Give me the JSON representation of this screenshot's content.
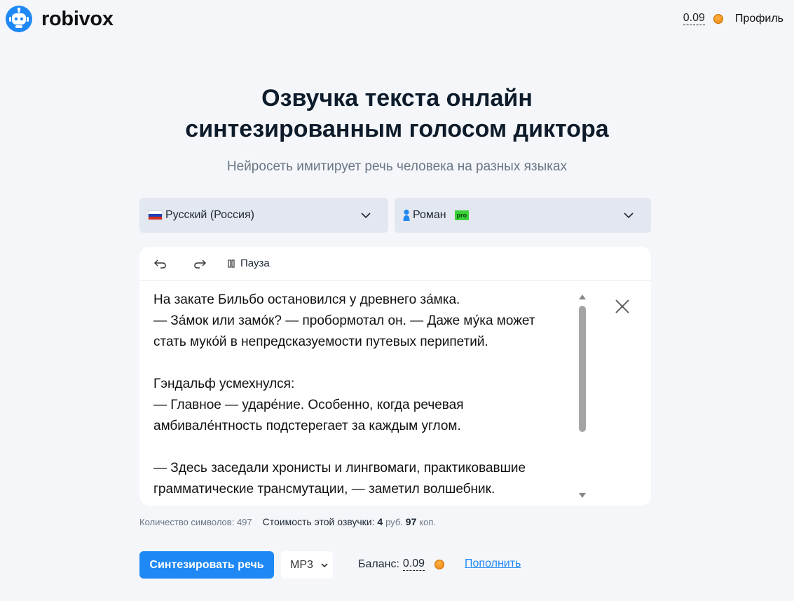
{
  "header": {
    "brand": "robivox",
    "balance": "0.09",
    "profile_label": "Профиль"
  },
  "hero": {
    "title_line1": "Озвучка текста онлайн",
    "title_line2": "синтезированным голосом диктора",
    "subtitle": "Нейросеть имитирует речь человека на разных языках"
  },
  "language_select": {
    "value": "Русский (Россия)"
  },
  "voice_select": {
    "value": "Роман",
    "badge": "pro"
  },
  "toolbar": {
    "pause_label": "Пауза"
  },
  "editor": {
    "lines": [
      "На закате Бильбо остановился у древнего за́мка.",
      "— За́мок или замо́к? — пробормотал он. — Даже му́ка может",
      "стать муко́й в непредсказуемости путевых перипетий.",
      "",
      "Гэндальф усмехнулся:",
      "— Главное — ударе́ние. Особенно, когда речевая",
      "амбивале́нтность подстерегает за каждым углом.",
      "",
      "— Здесь заседали хронисты и лингвомаги, практиковавшие",
      "грамматические трансмутации, — заметил волшебник."
    ]
  },
  "stats": {
    "chars_label": "Количество символов:",
    "chars_value": "497",
    "cost_label": "Стоимость этой озвучки:",
    "rub_value": "4",
    "rub_unit": "руб.",
    "kop_value": "97",
    "kop_unit": "коп."
  },
  "actions": {
    "synth_label": "Синтезировать речь",
    "format_value": "MP3",
    "balance_label": "Баланс:",
    "balance_value": "0.09",
    "topup_label": "Пополнить"
  },
  "colors": {
    "accent": "#1e88f5",
    "background": "#f4f6fa",
    "pro_badge": "#3bd13b"
  },
  "icons": {
    "logo": "robot-icon",
    "coin": "coin-icon",
    "undo": "undo-icon",
    "redo": "redo-icon",
    "pause": "pause-icon",
    "close": "close-icon",
    "chevron": "chevron-down-icon"
  }
}
